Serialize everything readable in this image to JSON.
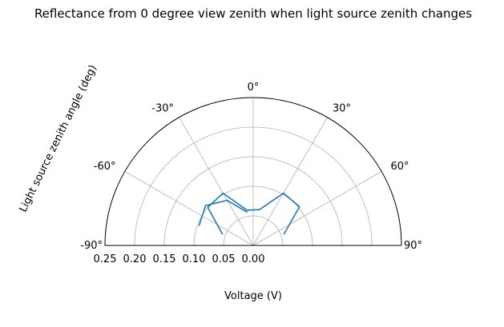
{
  "chart_data": {
    "type": "line",
    "projection": "polar-semicircle",
    "title": "Reflectance from 0 degree view zenith when light source zenith changes",
    "xlabel": "Voltage (V)",
    "ylabel": "Light source zenith angle (deg)",
    "theta_ticks": [
      {
        "deg": -90,
        "label": "-90°"
      },
      {
        "deg": -60,
        "label": "-60°"
      },
      {
        "deg": -30,
        "label": "-30°"
      },
      {
        "deg": 0,
        "label": "0°"
      },
      {
        "deg": 30,
        "label": "30°"
      },
      {
        "deg": 60,
        "label": "60°"
      },
      {
        "deg": 90,
        "label": "90°"
      }
    ],
    "r_ticks": [
      {
        "value": 0.25,
        "label": "0.25"
      },
      {
        "value": 0.2,
        "label": "0.20"
      },
      {
        "value": 0.15,
        "label": "0.15"
      },
      {
        "value": 0.1,
        "label": "0.10"
      },
      {
        "value": 0.05,
        "label": "0.05"
      },
      {
        "value": 0.0,
        "label": "0.00"
      }
    ],
    "rlim": [
      0,
      0.25
    ],
    "thetalim": [
      -90,
      90
    ],
    "grid": true,
    "colors": {
      "series": "#1f77b4",
      "grid": "#b0b0b0",
      "frame": "#000000"
    },
    "series": [
      {
        "theta": [
          -70,
          -50,
          -30,
          -10,
          10,
          30,
          50,
          70
        ],
        "r": [
          0.055,
          0.1,
          0.102,
          0.0605,
          0.0615,
          0.102,
          0.102,
          0.055
        ]
      },
      {
        "theta": [
          -70,
          -50,
          -30,
          -10
        ],
        "r": [
          0.097,
          0.105,
          0.088,
          0.057
        ]
      }
    ]
  }
}
